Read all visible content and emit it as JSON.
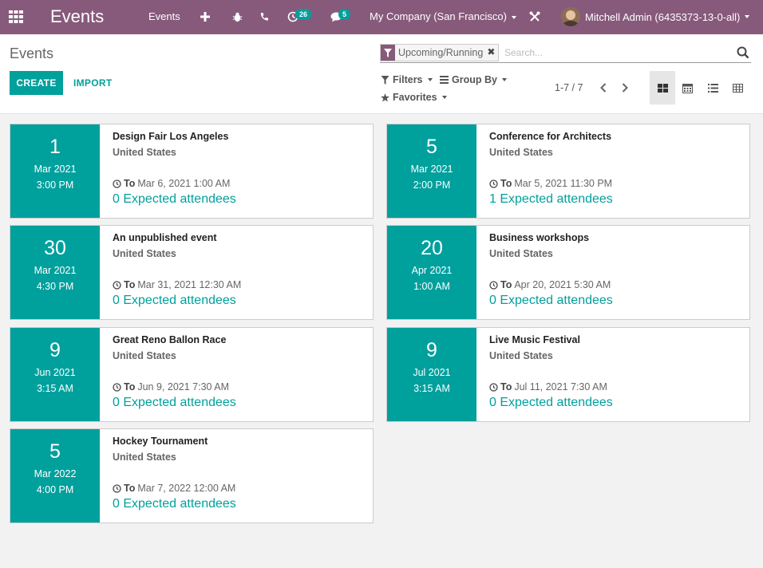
{
  "navbar": {
    "app_name": "Events",
    "menu_events": "Events",
    "activity_badge": "26",
    "messages_badge": "5",
    "company": "My Company (San Francisco)",
    "user": "Mitchell Admin (6435373-13-0-all)"
  },
  "control_panel": {
    "breadcrumb": "Events",
    "create_label": "CREATE",
    "import_label": "IMPORT",
    "facet_label": "Upcoming/Running",
    "search_placeholder": "Search...",
    "filters_label": "Filters",
    "groupby_label": "Group By",
    "favorites_label": "Favorites",
    "pager": "1-7 / 7"
  },
  "events": [
    {
      "day": "1",
      "month": "Mar 2021",
      "time": "3:00 PM",
      "name": "Design Fair Los Angeles",
      "country": "United States",
      "to_label": "To",
      "end": "Mar 6, 2021 1:00 AM",
      "attendees": "0 Expected attendees"
    },
    {
      "day": "5",
      "month": "Mar 2021",
      "time": "2:00 PM",
      "name": "Conference for Architects",
      "country": "United States",
      "to_label": "To",
      "end": "Mar 5, 2021 11:30 PM",
      "attendees": "1 Expected attendees"
    },
    {
      "day": "30",
      "month": "Mar 2021",
      "time": "4:30 PM",
      "name": "An unpublished event",
      "country": "United States",
      "to_label": "To",
      "end": "Mar 31, 2021 12:30 AM",
      "attendees": "0 Expected attendees"
    },
    {
      "day": "20",
      "month": "Apr 2021",
      "time": "1:00 AM",
      "name": "Business workshops",
      "country": "United States",
      "to_label": "To",
      "end": "Apr 20, 2021 5:30 AM",
      "attendees": "0 Expected attendees"
    },
    {
      "day": "9",
      "month": "Jun 2021",
      "time": "3:15 AM",
      "name": "Great Reno Ballon Race",
      "country": "United States",
      "to_label": "To",
      "end": "Jun 9, 2021 7:30 AM",
      "attendees": "0 Expected attendees"
    },
    {
      "day": "9",
      "month": "Jul 2021",
      "time": "3:15 AM",
      "name": "Live Music Festival",
      "country": "United States",
      "to_label": "To",
      "end": "Jul 11, 2021 7:30 AM",
      "attendees": "0 Expected attendees"
    },
    {
      "day": "5",
      "month": "Mar 2022",
      "time": "4:00 PM",
      "name": "Hockey Tournament",
      "country": "United States",
      "to_label": "To",
      "end": "Mar 7, 2022 12:00 AM",
      "attendees": "0 Expected attendees"
    }
  ],
  "icons": {
    "apps": "apps-grid-icon",
    "plus": "plus-icon",
    "bug": "bug-icon",
    "phone": "phone-icon",
    "activity": "clock-icon",
    "messages": "chat-icon",
    "tools": "tools-icon",
    "search": "search-icon",
    "facet": "filter-icon"
  },
  "colors": {
    "navbar": "#875a7b",
    "accent": "#00a09d"
  }
}
